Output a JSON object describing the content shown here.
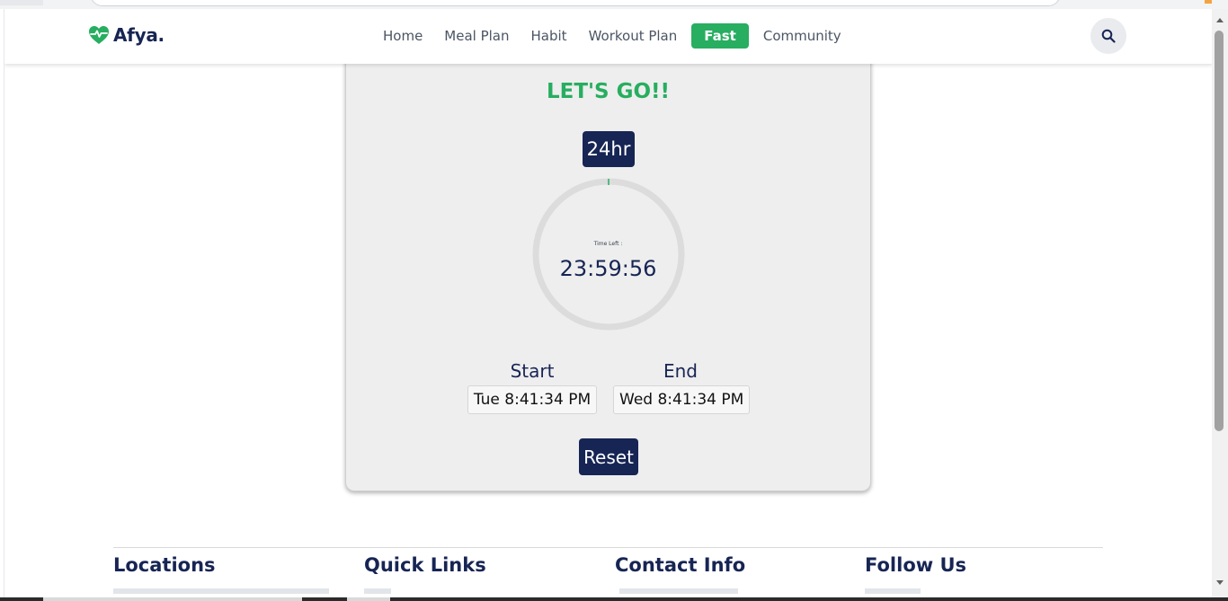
{
  "app": {
    "name": "Afya."
  },
  "nav": {
    "items": [
      {
        "label": "Home",
        "active": false
      },
      {
        "label": "Meal Plan",
        "active": false
      },
      {
        "label": "Habit",
        "active": false
      },
      {
        "label": "Workout Plan",
        "active": false
      },
      {
        "label": "Fast",
        "active": true
      },
      {
        "label": "Community",
        "active": false
      }
    ],
    "search_icon": "search-icon"
  },
  "fast": {
    "title": "LET'S GO!!",
    "duration": "24hr",
    "progress_fraction": 0.0,
    "time_left_label": "Time Left :",
    "time_left": "23:59:56",
    "start_label": "Start",
    "start_value": "Tue 8:41:34 PM",
    "end_label": "End",
    "end_value": "Wed 8:41:34 PM",
    "reset_label": "Reset"
  },
  "footer": {
    "locations": "Locations",
    "quick_links": "Quick Links",
    "contact_info": "Contact Info",
    "follow_us": "Follow Us"
  },
  "colors": {
    "brand_green": "#27ae60",
    "navy": "#172554",
    "card_bg": "#eeeeee"
  }
}
